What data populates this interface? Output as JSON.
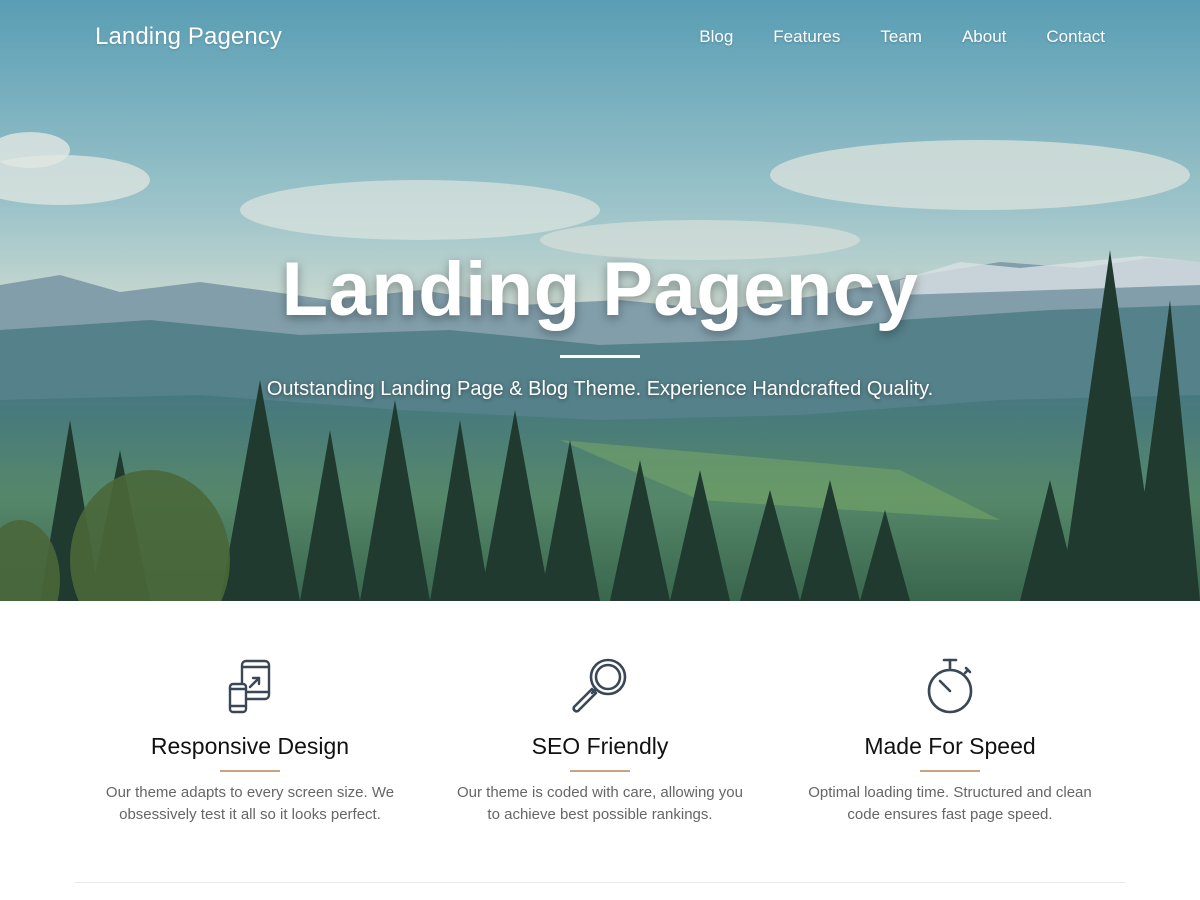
{
  "header": {
    "brand": "Landing Pagency",
    "nav": [
      {
        "label": "Blog"
      },
      {
        "label": "Features"
      },
      {
        "label": "Team"
      },
      {
        "label": "About"
      },
      {
        "label": "Contact"
      }
    ]
  },
  "hero": {
    "title": "Landing Pagency",
    "subtitle": "Outstanding Landing Page & Blog Theme. Experience Handcrafted Quality."
  },
  "features": [
    {
      "icon": "responsive-devices-icon",
      "title": "Responsive Design",
      "text": "Our theme adapts to every screen size. We obsessively test it all so it looks perfect."
    },
    {
      "icon": "magnifier-icon",
      "title": "SEO Friendly",
      "text": "Our theme is coded with care, allowing you to achieve best possible rankings."
    },
    {
      "icon": "stopwatch-icon",
      "title": "Made For Speed",
      "text": "Optimal loading time. Structured and clean code ensures fast page speed."
    }
  ],
  "colors": {
    "accent_divider": "#c9a27e",
    "icon_stroke": "#3a4756",
    "feature_text": "#666666"
  }
}
